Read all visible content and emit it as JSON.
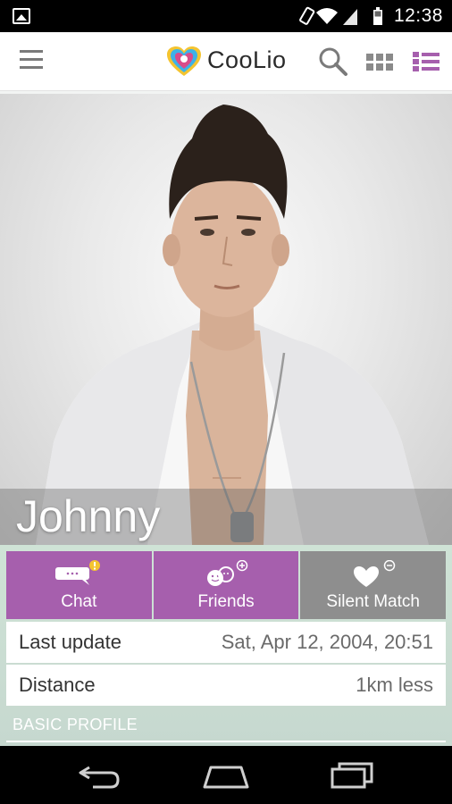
{
  "status_bar": {
    "time": "12:38",
    "icons": [
      "gallery-icon",
      "vibrate-icon",
      "wifi-icon",
      "signal-icon",
      "battery-icon"
    ]
  },
  "header": {
    "app_name": "CooLio",
    "icons": [
      "menu-icon",
      "search-icon",
      "grid-view-icon",
      "list-view-icon"
    ],
    "accent": "#a65fad"
  },
  "profile": {
    "name": "Johnny"
  },
  "actions": [
    {
      "label": "Chat",
      "icon": "chat-icon",
      "color": "#a65fad"
    },
    {
      "label": "Friends",
      "icon": "friends-add-icon",
      "color": "#a65fad"
    },
    {
      "label": "Silent Match",
      "icon": "heart-minus-icon",
      "color": "#8e8e8e"
    }
  ],
  "info": {
    "last_update_label": "Last update",
    "last_update_value": "Sat, Apr 12, 2004, 20:51",
    "distance_label": "Distance",
    "distance_value": "1km less"
  },
  "section": {
    "basic_profile": "BASIC PROFILE"
  },
  "nav": {
    "icons": [
      "back-icon",
      "home-icon",
      "recent-apps-icon"
    ]
  }
}
